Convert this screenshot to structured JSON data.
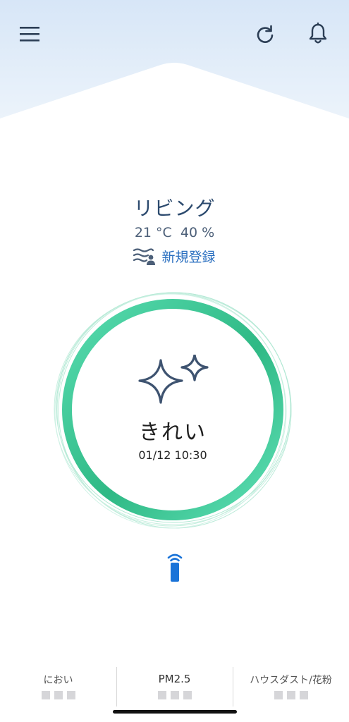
{
  "header": {
    "menu_icon": "hamburger-menu-icon",
    "refresh_icon": "refresh-icon",
    "bell_icon": "bell-icon"
  },
  "room": {
    "name": "リビング",
    "temperature": "21 °C",
    "humidity": "40 %",
    "register_icon": "air-flow-person-icon",
    "register_label": "新規登録"
  },
  "status": {
    "label": "きれい",
    "timestamp": "01/12 10:30",
    "icon": "sparkle-icon"
  },
  "remote": {
    "icon": "remote-control-icon"
  },
  "metrics": [
    {
      "label": "におい",
      "level": 0
    },
    {
      "label": "PM2.5",
      "level": 0
    },
    {
      "label": "ハウスダスト/花粉",
      "level": 0
    }
  ],
  "colors": {
    "accent_green": "#3fcb9a",
    "text_blue": "#2a6fc0",
    "sky_blue": "#dbe9f8",
    "remote_blue": "#1a73d8"
  }
}
